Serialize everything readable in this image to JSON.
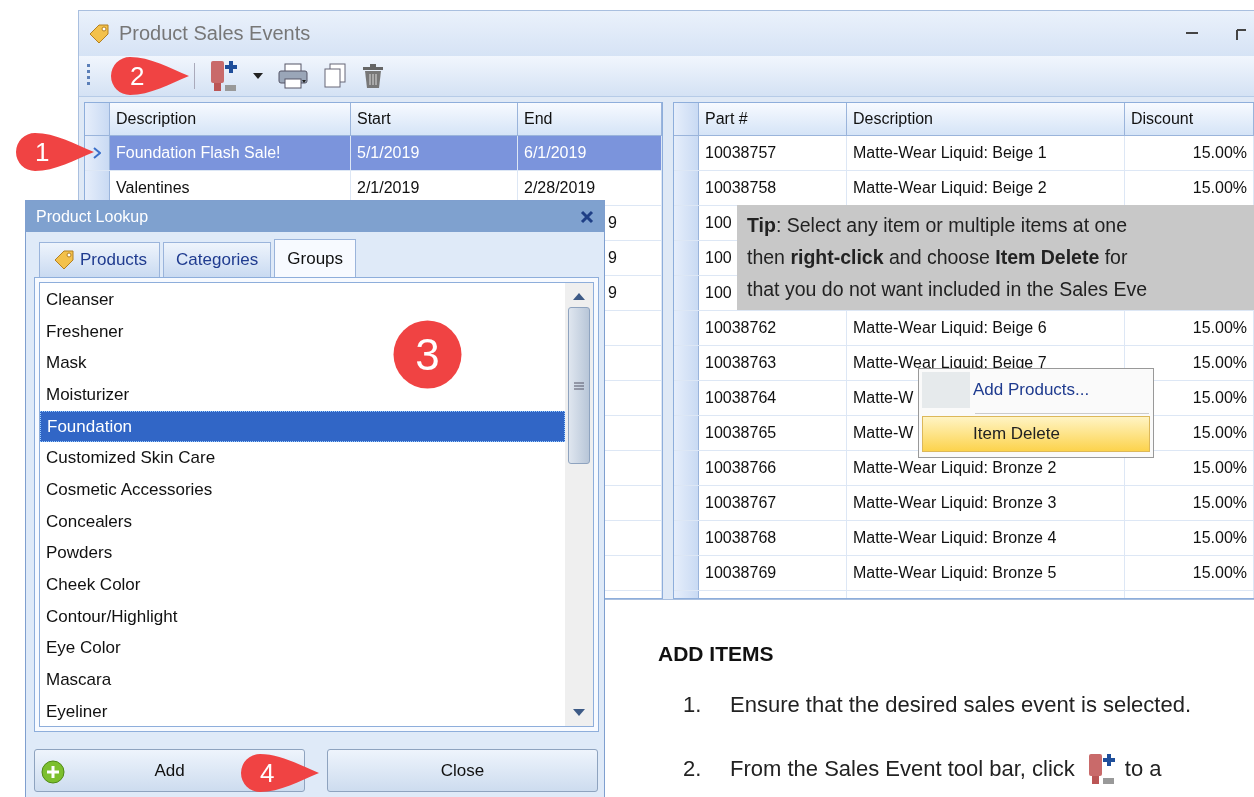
{
  "window": {
    "title": "Product Sales Events"
  },
  "events_grid": {
    "columns": [
      "Description",
      "Start",
      "End"
    ],
    "rows": [
      {
        "description": "Foundation Flash Sale!",
        "start": "5/1/2019",
        "end": "6/1/2019",
        "selected": true
      },
      {
        "description": "Valentines",
        "start": "2/1/2019",
        "end": "2/28/2019",
        "selected": false
      },
      {
        "end": "9",
        "selected": false
      },
      {
        "end": "9",
        "selected": false
      },
      {
        "end": "9",
        "selected": false
      }
    ]
  },
  "items_grid": {
    "columns": [
      "Part #",
      "Description",
      "Discount"
    ],
    "rows": [
      {
        "part": "10038757",
        "description": "Matte-Wear Liquid: Beige 1",
        "discount": "15.00%"
      },
      {
        "part": "10038758",
        "description": "Matte-Wear Liquid: Beige 2",
        "discount": "15.00%"
      },
      {
        "part": "100"
      },
      {
        "part": "100"
      },
      {
        "part": "100"
      },
      {
        "part": "10038762",
        "description": "Matte-Wear Liquid: Beige 6",
        "discount": "15.00%"
      },
      {
        "part": "10038763",
        "description": "Matte-Wear Liquid: Beige 7",
        "discount": "15.00%"
      },
      {
        "part": "10038764",
        "description": "Matte-W",
        "discount": "15.00%"
      },
      {
        "part": "10038765",
        "description": "Matte-W",
        "discount": "15.00%"
      },
      {
        "part": "10038766",
        "description": "Matte-Wear Liquid: Bronze 2",
        "discount": "15.00%"
      },
      {
        "part": "10038767",
        "description": "Matte-Wear Liquid: Bronze 3",
        "discount": "15.00%"
      },
      {
        "part": "10038768",
        "description": "Matte-Wear Liquid: Bronze 4",
        "discount": "15.00%"
      },
      {
        "part": "10038769",
        "description": "Matte-Wear Liquid: Bronze 5",
        "discount": "15.00%"
      }
    ]
  },
  "tip": {
    "lines": [
      "**Tip**: Select any item or multiple items at one",
      "then **right-click** and choose **Item Delete** for",
      "that you do not want included in the Sales Eve"
    ]
  },
  "context_menu": {
    "items": [
      {
        "label": "Add Products...",
        "selected": false
      },
      {
        "label": "Item Delete",
        "selected": true
      }
    ]
  },
  "product_lookup": {
    "title": "Product Lookup",
    "tabs": [
      {
        "label": "Products",
        "selected": false
      },
      {
        "label": "Categories",
        "selected": false
      },
      {
        "label": "Groups",
        "selected": true
      }
    ],
    "groups": [
      {
        "label": "Cleanser",
        "selected": false
      },
      {
        "label": "Freshener",
        "selected": false
      },
      {
        "label": "Mask",
        "selected": false
      },
      {
        "label": "Moisturizer",
        "selected": false
      },
      {
        "label": "Foundation",
        "selected": true
      },
      {
        "label": "Customized Skin Care",
        "selected": false
      },
      {
        "label": "Cosmetic Accessories",
        "selected": false
      },
      {
        "label": "Concealers",
        "selected": false
      },
      {
        "label": "Powders",
        "selected": false
      },
      {
        "label": "Cheek Color",
        "selected": false
      },
      {
        "label": "Contour/Highlight",
        "selected": false
      },
      {
        "label": "Eye Color",
        "selected": false
      },
      {
        "label": "Mascara",
        "selected": false
      },
      {
        "label": "Eyeliner",
        "selected": false
      }
    ],
    "buttons": [
      {
        "label": "Add",
        "kind": "add"
      },
      {
        "label": "Close",
        "kind": "plain"
      }
    ]
  },
  "document": {
    "heading": "ADD ITEMS",
    "steps": [
      {
        "number": "1.",
        "text": "Ensure that the desired sales event is selected."
      },
      {
        "number": "2.",
        "text": "From the Sales Event tool bar, click",
        "after": "to a"
      }
    ]
  },
  "callouts": [
    {
      "label": "1",
      "kind": "pointer"
    },
    {
      "label": "2",
      "kind": "pointer"
    },
    {
      "label": "3",
      "kind": "circle"
    },
    {
      "label": "4",
      "kind": "pointer"
    }
  ]
}
